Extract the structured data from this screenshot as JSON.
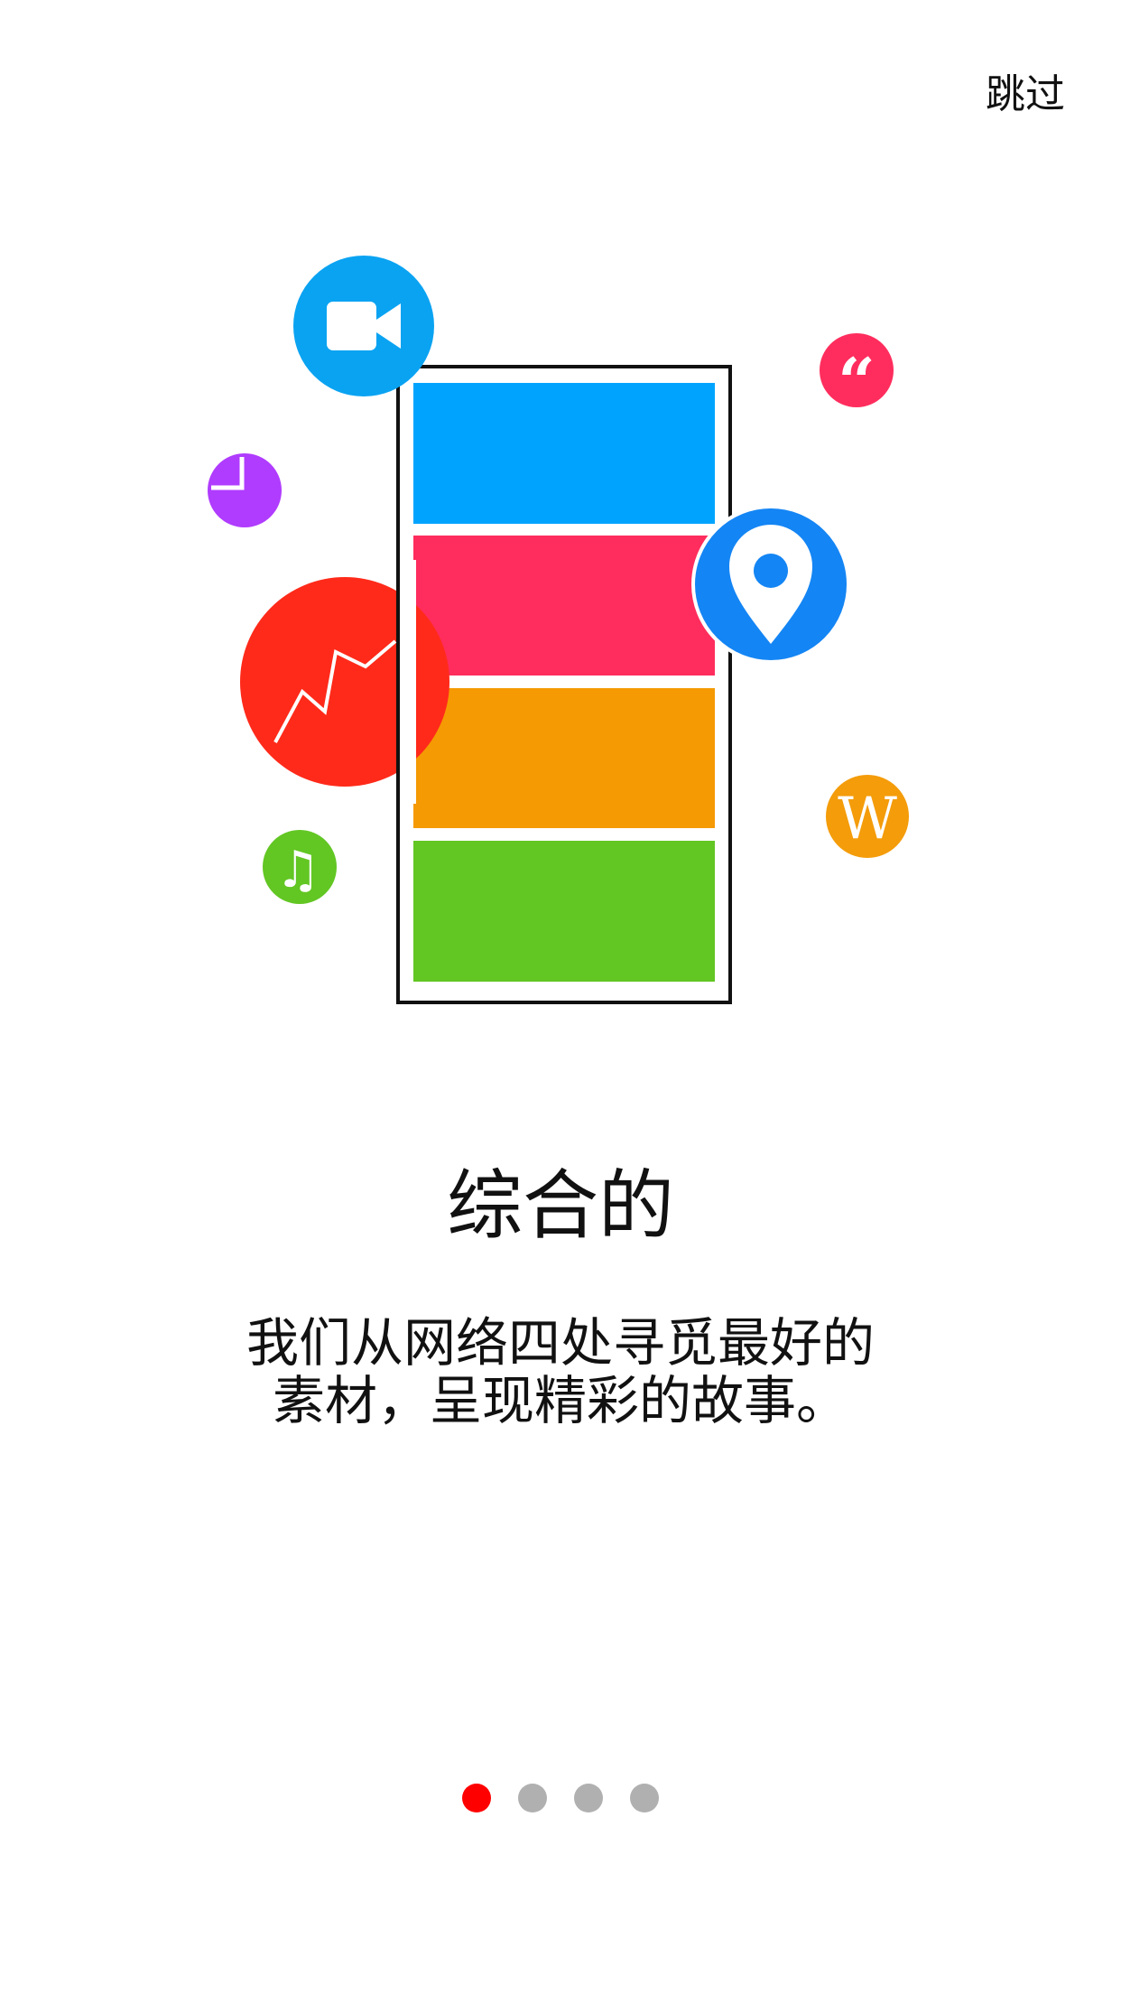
{
  "header": {
    "skip_label": "跳过"
  },
  "illustration": {
    "card_colors": [
      "#00a4ff",
      "#ff2d5d",
      "#f59a02",
      "#62c623"
    ],
    "icons": [
      {
        "name": "video-camera-icon",
        "color": "#0aa3f2"
      },
      {
        "name": "quote-icon",
        "color": "#ff2d5d"
      },
      {
        "name": "pie-chart-icon",
        "color": "#b03cff"
      },
      {
        "name": "location-pin-icon",
        "color": "#1485f4"
      },
      {
        "name": "trend-chart-icon",
        "color": "#ff2a1a"
      },
      {
        "name": "music-note-icon",
        "color": "#62c623"
      },
      {
        "name": "wikipedia-icon",
        "color": "#f49c0a"
      }
    ],
    "quote_glyph": "“",
    "wiki_glyph": "W",
    "music_glyph": "♫"
  },
  "content": {
    "title": "综合的",
    "description_line1": "我们从网络四处寻觅最好的",
    "description_line2": "素材，呈现精彩的故事。"
  },
  "pagination": {
    "total": 4,
    "active_index": 0,
    "active_color": "#ff0000",
    "inactive_color": "#b0b0b0"
  }
}
